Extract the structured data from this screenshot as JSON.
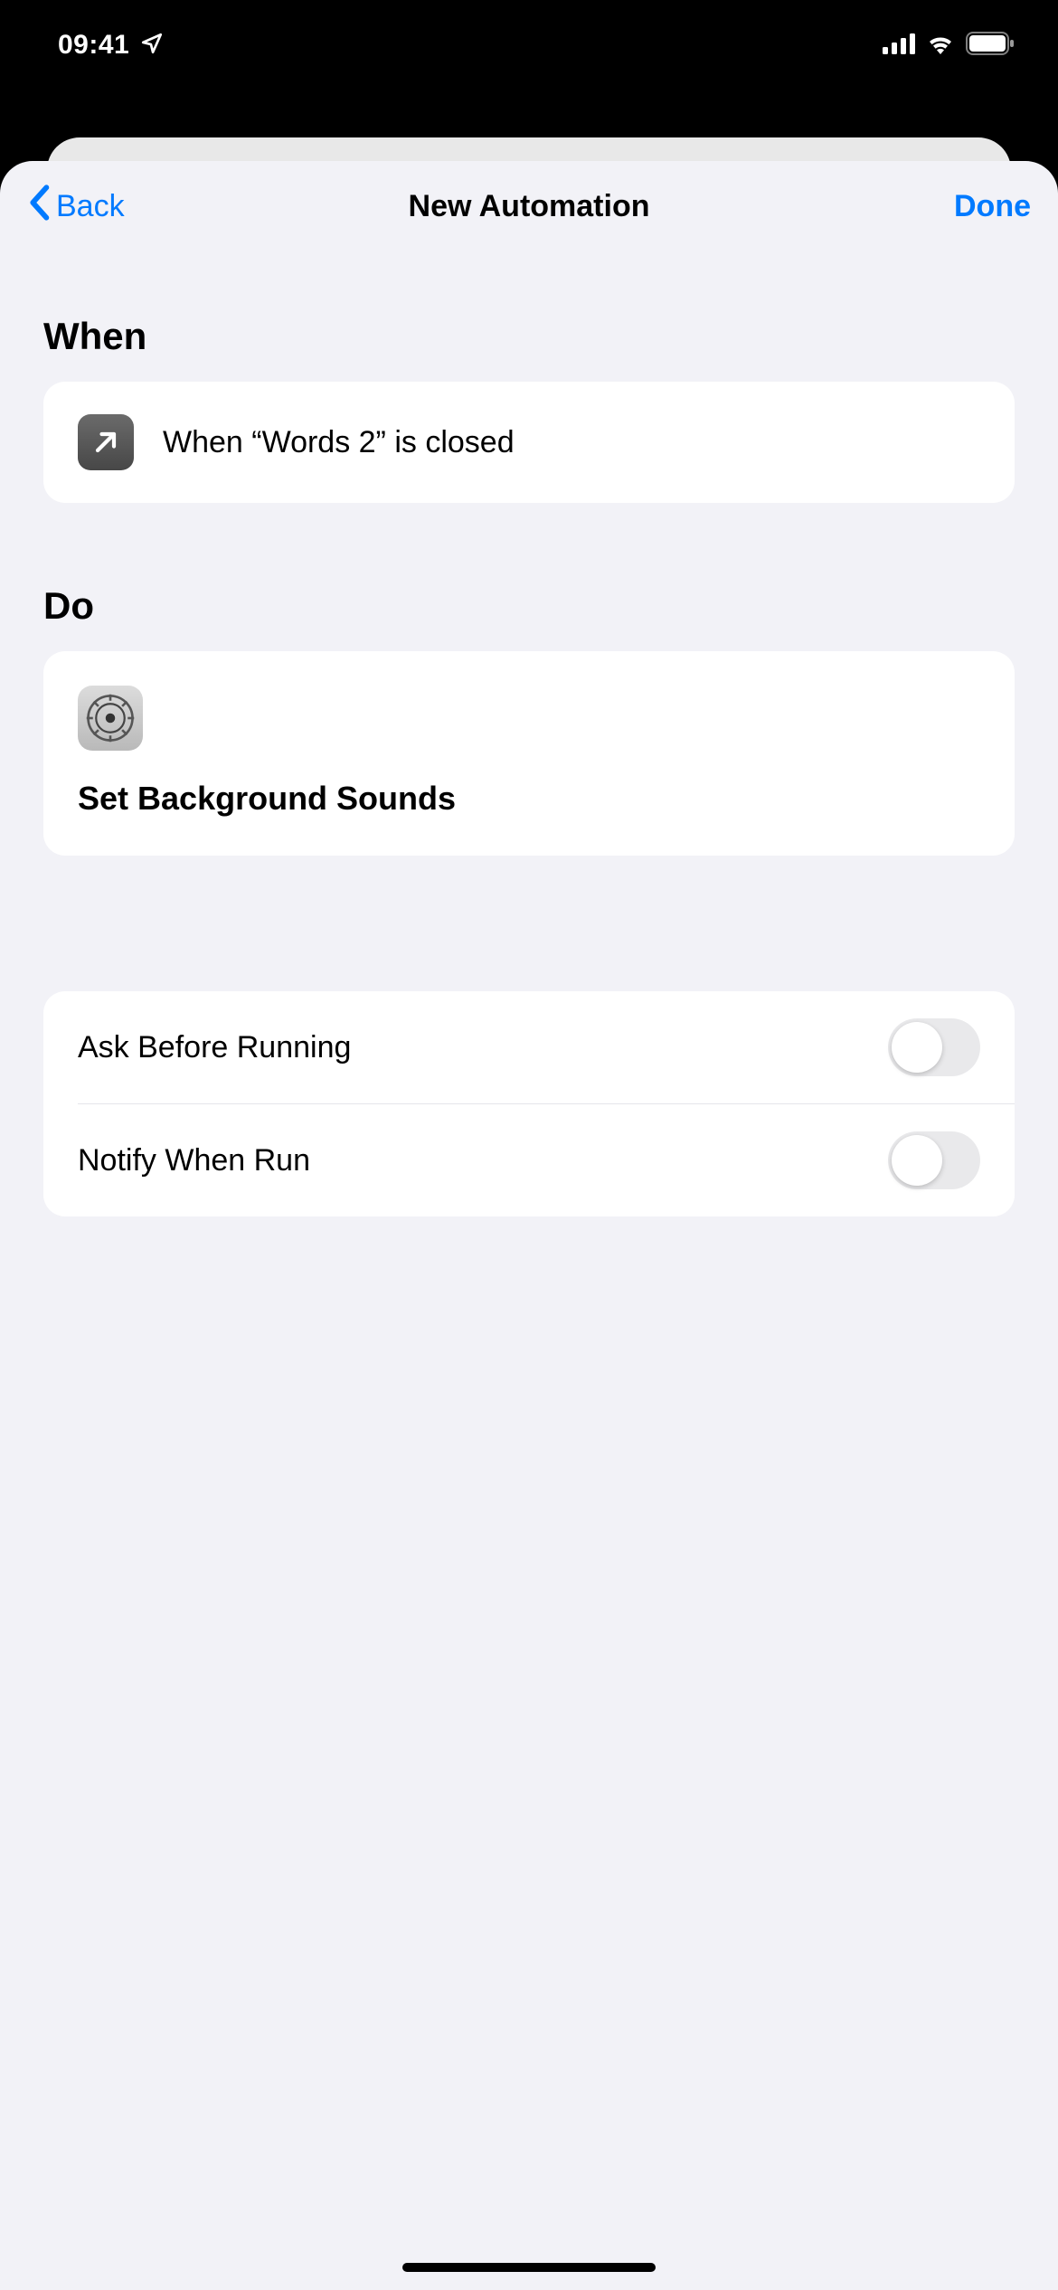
{
  "statusBar": {
    "time": "09:41"
  },
  "nav": {
    "back": "Back",
    "title": "New Automation",
    "done": "Done"
  },
  "sections": {
    "when": {
      "header": "When",
      "condition": "When “Words 2” is closed"
    },
    "do": {
      "header": "Do",
      "action": "Set Background Sounds"
    }
  },
  "options": {
    "askBeforeRunning": {
      "label": "Ask Before Running",
      "enabled": false
    },
    "notifyWhenRun": {
      "label": "Notify When Run",
      "enabled": false
    }
  }
}
